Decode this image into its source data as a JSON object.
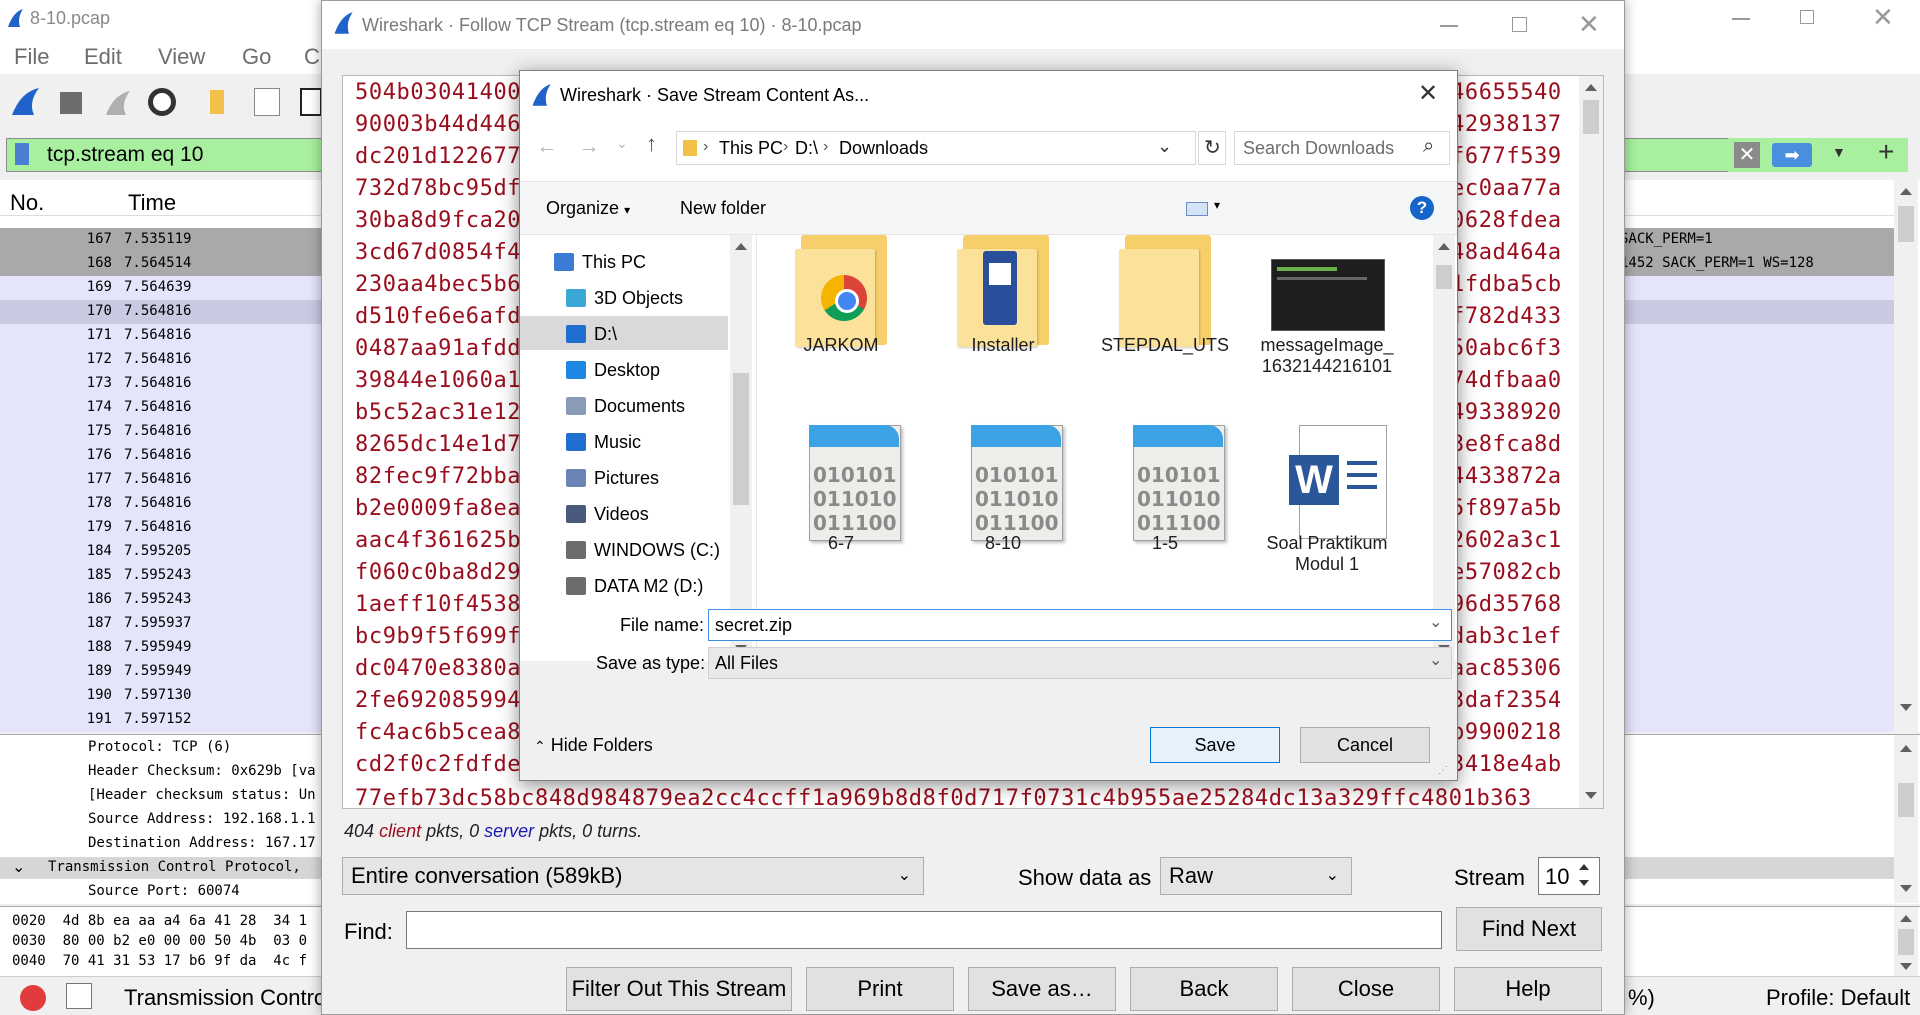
{
  "main_window": {
    "title": "8-10.pcap",
    "menu": [
      "File",
      "Edit",
      "View",
      "Go",
      "C"
    ],
    "filter_text": "tcp.stream eq 10",
    "columns": {
      "no": "No.",
      "time": "Time"
    },
    "packets": [
      {
        "no": "167",
        "time": "7.535119",
        "info": "SACK_PERM=1"
      },
      {
        "no": "168",
        "time": "7.564514",
        "info": "1452 SACK_PERM=1 WS=128"
      },
      {
        "no": "169",
        "time": "7.564639",
        "info": ""
      },
      {
        "no": "170",
        "time": "7.564816",
        "info": ""
      },
      {
        "no": "171",
        "time": "7.564816",
        "info": ""
      },
      {
        "no": "172",
        "time": "7.564816",
        "info": ""
      },
      {
        "no": "173",
        "time": "7.564816",
        "info": ""
      },
      {
        "no": "174",
        "time": "7.564816",
        "info": ""
      },
      {
        "no": "175",
        "time": "7.564816",
        "info": ""
      },
      {
        "no": "176",
        "time": "7.564816",
        "info": ""
      },
      {
        "no": "177",
        "time": "7.564816",
        "info": ""
      },
      {
        "no": "178",
        "time": "7.564816",
        "info": ""
      },
      {
        "no": "179",
        "time": "7.564816",
        "info": ""
      },
      {
        "no": "184",
        "time": "7.595205",
        "info": ""
      },
      {
        "no": "185",
        "time": "7.595243",
        "info": ""
      },
      {
        "no": "186",
        "time": "7.595243",
        "info": ""
      },
      {
        "no": "187",
        "time": "7.595937",
        "info": ""
      },
      {
        "no": "188",
        "time": "7.595949",
        "info": ""
      },
      {
        "no": "189",
        "time": "7.595949",
        "info": ""
      },
      {
        "no": "190",
        "time": "7.597130",
        "info": ""
      },
      {
        "no": "191",
        "time": "7.597152",
        "info": ""
      }
    ],
    "details": [
      "Protocol: TCP (6)",
      "Header Checksum: 0x629b [va",
      "[Header checksum status: Un",
      "Source Address: 192.168.1.1",
      "Destination Address: 167.17",
      "Transmission Control Protocol,",
      "Source Port: 60074"
    ],
    "hex": [
      "0020  4d 8b ea aa a4 6a 41 28  34 1",
      "0030  80 00 b2 e0 00 00 50 4b  03 0",
      "0040  70 41 31 53 17 b6 9f da  4c f"
    ],
    "status_left": "Transmission Contro",
    "status_pct": "%)",
    "status_profile": "Profile: Default"
  },
  "follow_window": {
    "title": "Wireshark · Follow TCP Stream (tcp.stream eq 10) · 8-10.pcap",
    "stream_left": [
      "504b03041400",
      "90003b44d446",
      "dc201d122677",
      "732d78bc95df",
      "30ba8d9fca20",
      "3cd67d0854f4",
      "230aa4bec5b6",
      "d510fe6e6afd",
      "0487aa91afdd",
      "39844e1060a1",
      "b5c52ac31e12",
      "8265dc14e1d7",
      "82fec9f72bba",
      "b2e0009fa8ea",
      "aac4f361625b",
      "f060c0ba8d29",
      "1aeff10f4538",
      "bc9b9f5f699f",
      "dc0470e8380a",
      "2fe692085994",
      "fc4ac6b5cea8",
      "cd2f0c2fdfde"
    ],
    "stream_right": [
      "46655540",
      "42938137",
      "f677f539",
      "ec0aa77a",
      "0628fdea",
      "48ad464a",
      "1fdba5cb",
      "f782d433",
      "50abc6f3",
      "74dfbaa0",
      "49338920",
      "3e8fca8d",
      "4433872a",
      "5f897a5b",
      "2602a3c1",
      "e57082cb",
      "96d35768",
      "dab3c1ef",
      "aac85306",
      "3daf2354",
      "b9900218",
      "3418e4ab"
    ],
    "stream_last": "77efb73dc58bc848d984879ea2cc4ccff1a969b8d8f0d717f0731c4b955ae25284dc13a329ffc4801b363",
    "summary": {
      "n1": "404",
      "client": "client",
      "mid": " pkts, 0 ",
      "server": "server",
      "end": " pkts, 0 turns."
    },
    "conversation": "Entire conversation (589kB)",
    "show_data_as_label": "Show data as",
    "show_data_as": "Raw",
    "stream_label": "Stream",
    "stream_value": "10",
    "find_label": "Find:",
    "find_value": "",
    "find_next": "Find Next",
    "buttons": [
      "Filter Out This Stream",
      "Print",
      "Save as…",
      "Back",
      "Close",
      "Help"
    ]
  },
  "save_dialog": {
    "title": "Wireshark · Save Stream Content As...",
    "breadcrumb": [
      "This PC",
      "D:\\",
      "Downloads"
    ],
    "search_placeholder": "Search Downloads",
    "organize": "Organize",
    "new_folder": "New folder",
    "nav": [
      "This PC",
      "3D Objects",
      "D:\\",
      "Desktop",
      "Documents",
      "Music",
      "Pictures",
      "Videos",
      "WINDOWS (C:)",
      "DATA M2 (D:)"
    ],
    "files": [
      {
        "name": "JARKOM",
        "icon": "chrome-folder-icon"
      },
      {
        "name": "Installer",
        "icon": "installer-folder-icon"
      },
      {
        "name": "STEPDAL_UTS",
        "icon": "folder-icon"
      },
      {
        "name": "messageImage_1632144216101",
        "icon": "image-thumbnail"
      },
      {
        "name": "6-7",
        "icon": "binary-file-icon"
      },
      {
        "name": "8-10",
        "icon": "binary-file-icon"
      },
      {
        "name": "1-5",
        "icon": "binary-file-icon"
      },
      {
        "name": "Soal Praktikum Modul 1",
        "icon": "word-document-icon"
      }
    ],
    "binary_lines": [
      "010101",
      "011010",
      "011100"
    ],
    "file_name_label": "File name:",
    "file_name": "secret.zip",
    "save_type_label": "Save as type:",
    "save_type": "All Files",
    "hide_folders": "Hide Folders",
    "save": "Save",
    "cancel": "Cancel"
  },
  "colors": {
    "stream_text": "#9a0d1c",
    "filter_bg": "#a8f0a0",
    "row_purple": "#e4e4fb",
    "row_gray": "#a9a9a9",
    "accent": "#0078d7"
  }
}
